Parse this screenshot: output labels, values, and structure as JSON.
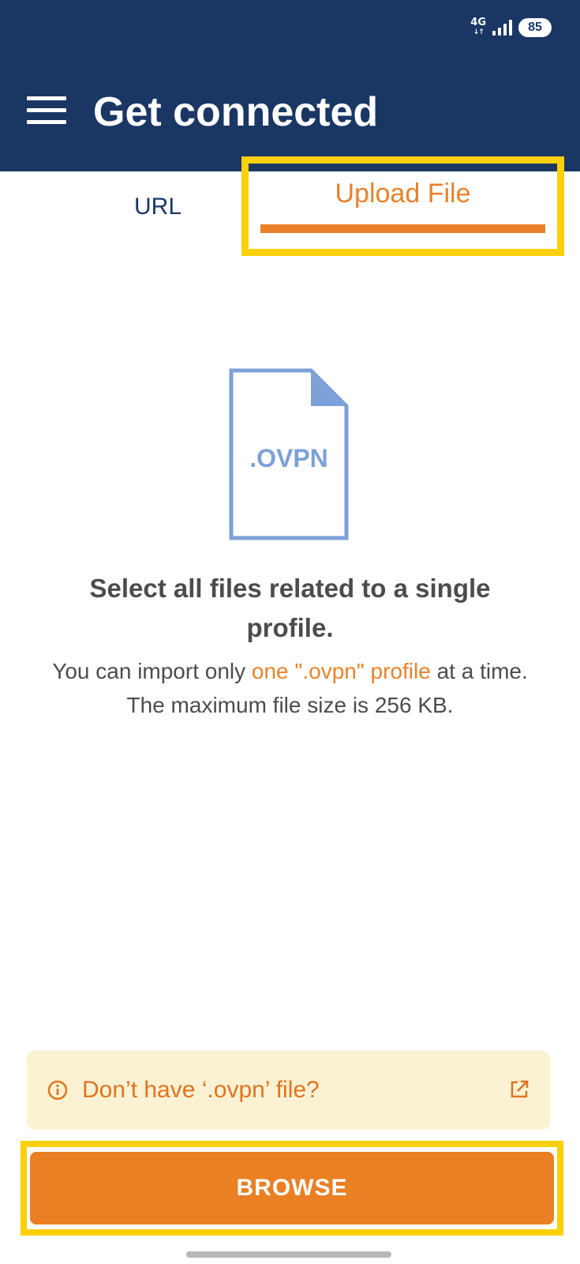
{
  "status_bar": {
    "network": "4G",
    "network_arrows": "↓↑",
    "battery": "85"
  },
  "header": {
    "title": "Get connected"
  },
  "tabs": [
    {
      "label": "URL",
      "selected": false
    },
    {
      "label": "Upload File",
      "selected": true
    }
  ],
  "file_icon": {
    "label": ".OVPN",
    "color": "#7da0d8"
  },
  "content": {
    "headline": "Select all files related to a single profile.",
    "desc_prefix": "You can import only ",
    "desc_accent": "one \".ovpn\" profile",
    "desc_suffix": " at a time.",
    "desc_size": "The maximum file size is 256 KB."
  },
  "info": {
    "text": "Don’t have ‘.ovpn’ file?"
  },
  "browse": {
    "label": "BROWSE"
  },
  "colors": {
    "header_bg": "#1a3764",
    "accent": "#ea8128",
    "highlight": "#fcd00a",
    "info_bg": "#fbf1d3"
  }
}
